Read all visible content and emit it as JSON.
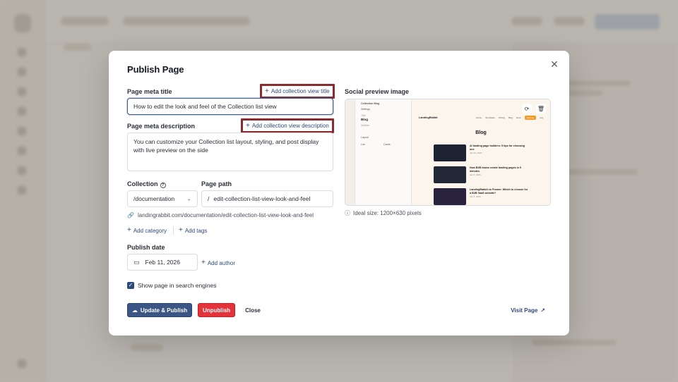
{
  "modal": {
    "title": "Publish Page",
    "close_icon": "close-icon",
    "meta_title": {
      "label": "Page meta title",
      "value": "How to edit the look and feel of the Collection list view",
      "add_link": "Add collection view title"
    },
    "meta_description": {
      "label": "Page meta description",
      "value": "You can customize your Collection list layout, styling, and post display with live preview on the side",
      "add_link": "Add collection view description"
    },
    "collection": {
      "label": "Collection",
      "value": "/documentation"
    },
    "page_path": {
      "label": "Page path",
      "prefix": "/",
      "value": "edit-collection-list-view-look-and-feel"
    },
    "full_url": "landingrabbit.com/documentation/edit-collection-list-view-look-and-feel",
    "add_category": "Add category",
    "add_tags": "Add tags",
    "publish_date": {
      "label": "Publish date",
      "value": "Feb 11, 2026"
    },
    "add_author": "Add author",
    "search_engines": {
      "label": "Show page in search engines",
      "checked": true
    },
    "buttons": {
      "update_publish": "Update & Publish",
      "unpublish": "Unpublish",
      "close": "Close",
      "visit_page": "Visit Page"
    },
    "social_preview": {
      "label": "Social preview image",
      "ideal_size": "Ideal size: 1200×630 pixels",
      "preview": {
        "site_logo": "LandingRabbit",
        "heading": "Blog",
        "nav_links": [
          "Home",
          "Templates",
          "Pricing",
          "Blog",
          "Docs"
        ],
        "nav_cta": "Sign up",
        "nav_login": "Log",
        "panel_top": "Collection Blog",
        "panel_back": "Settings",
        "panel_title_label": "Title",
        "panel_title": "Blog",
        "panel_subtitle_label": "Subtitle",
        "panel_layout": "Layout",
        "panel_list": "List",
        "panel_cards": "Cards",
        "cards": [
          {
            "title": "AI landing page builders: 5 tips for choosing one",
            "date": "Jan 10, 2026"
          },
          {
            "title": "How B2B teams create landing pages in 5 minutes",
            "date": "Jan 8, 2026"
          },
          {
            "title": "LandingRabbit vs Framer: Which to choose for a B2B SaaS website?",
            "date": "Jan 5, 2026"
          }
        ]
      }
    }
  },
  "colors": {
    "primary": "#3b5585",
    "danger": "#e5333c",
    "highlight": "#8b2a2f",
    "link": "#2e4a7a"
  }
}
